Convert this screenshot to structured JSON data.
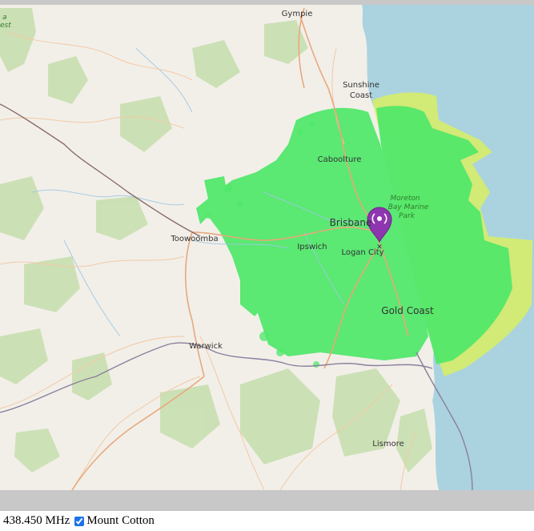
{
  "map": {
    "places": [
      {
        "name": "Gympie"
      },
      {
        "name": "Sunshine"
      },
      {
        "name": "Coast"
      },
      {
        "name": "Caboolture"
      },
      {
        "name": "Moreton"
      },
      {
        "name": "Bay Marine"
      },
      {
        "name": "Park"
      },
      {
        "name": "Brisbane"
      },
      {
        "name": "Toowoomba"
      },
      {
        "name": "Ipswich"
      },
      {
        "name": "Logan City"
      },
      {
        "name": "Gold Coast"
      },
      {
        "name": "Warwick"
      },
      {
        "name": "Lismore"
      },
      {
        "name": "a"
      },
      {
        "name": "est"
      }
    ],
    "marker": {
      "icon": "radio-tower-marker-icon",
      "color": "#8e35b0"
    },
    "coverage_colors": {
      "strong": "#4fe86a",
      "weak": "#d6ec6a",
      "ocean": "#aad3df",
      "land": "#f2efe9",
      "forest": "#c8dfb0"
    }
  },
  "footer": {
    "frequency": "438.450 MHz",
    "site_label": "Mount Cotton",
    "site_checked": true
  }
}
